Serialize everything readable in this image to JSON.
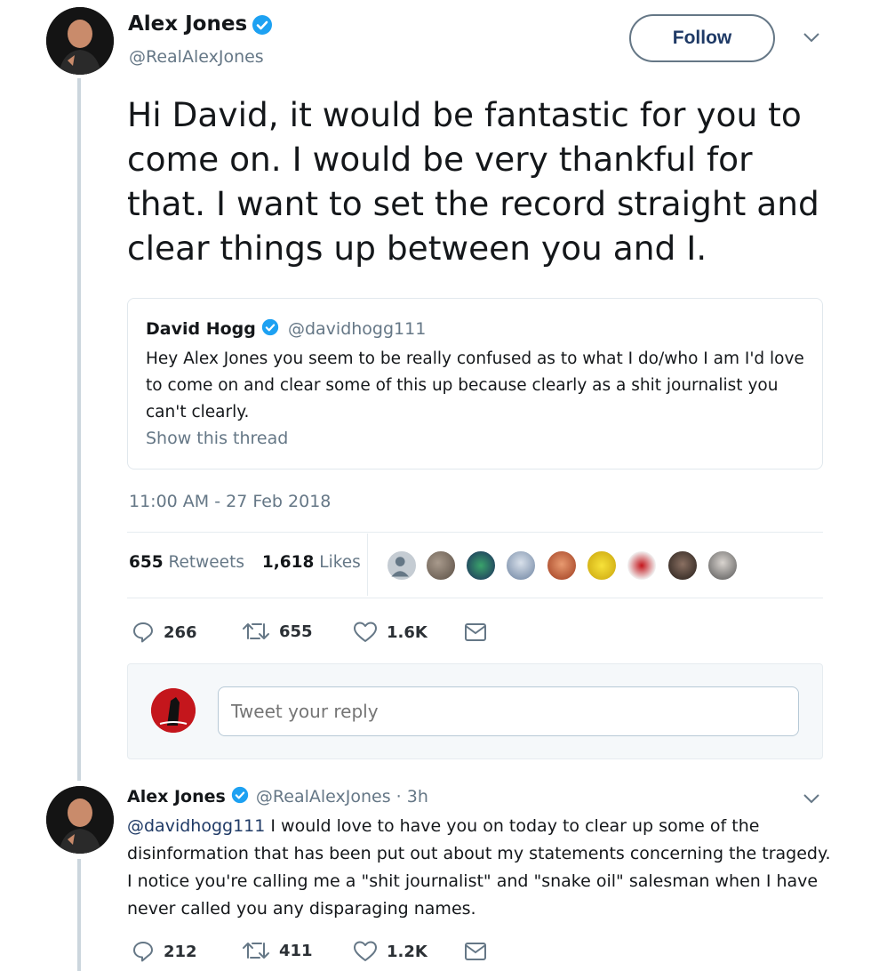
{
  "main_tweet": {
    "author_name": "Alex Jones",
    "author_handle": "@RealAlexJones",
    "follow_label": "Follow",
    "text": "Hi David, it would be fantastic for you to come on. I would be very thankful for that. I want to set the record straight and clear things up between you and I.",
    "quoted": {
      "author_name": "David Hogg",
      "author_handle": "@davidhogg111",
      "text": "Hey Alex Jones you seem to be really confused as to what I do/who I am I'd love to come on and clear some of this up because clearly as a shit journalist you can't clearly.",
      "show_thread": "Show this thread"
    },
    "timestamp": "11:00 AM - 27 Feb 2018",
    "stats": {
      "retweets_count": "655",
      "retweets_label": "Retweets",
      "likes_count": "1,618",
      "likes_label": "Likes"
    },
    "actions": {
      "replies": "266",
      "retweets": "655",
      "likes": "1.6K"
    }
  },
  "reply_composer": {
    "placeholder": "Tweet your reply"
  },
  "reply_tweet": {
    "author_name": "Alex Jones",
    "author_handle": "@RealAlexJones",
    "time": "· 3h",
    "mention": "@davidhogg111",
    "text": " I would love to have you on today to clear up some of the disinformation that has been put out about my statements concerning the tragedy. I notice you're calling me a \"shit journalist\" and \"snake oil\" salesman when I have never called you any disparaging names.",
    "actions": {
      "replies": "212",
      "retweets": "411",
      "likes": "1.2K"
    }
  },
  "colors": {
    "verified": "#1da1f2",
    "muted": "#657786",
    "follow_text": "#1f3a66",
    "divider": "#e6ecf0"
  },
  "icons": [
    "verified-badge-icon",
    "chevron-down-icon",
    "reply-icon",
    "retweet-icon",
    "heart-icon",
    "mail-icon"
  ]
}
